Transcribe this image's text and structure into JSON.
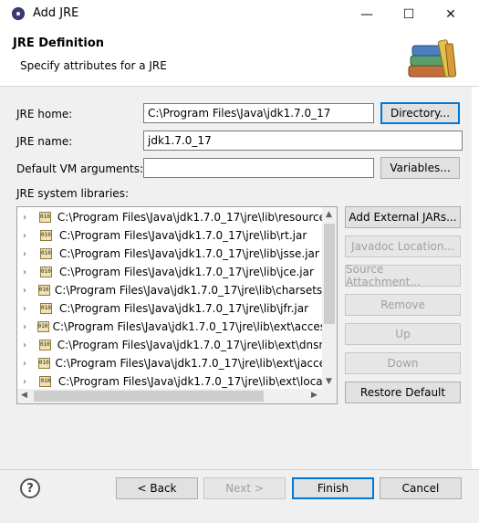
{
  "window": {
    "title": "Add JRE",
    "minimize_glyph": "—",
    "maximize_glyph": "☐",
    "close_glyph": "✕"
  },
  "header": {
    "title": "JRE Definition",
    "message": "Specify attributes for a JRE",
    "icon": "books-icon"
  },
  "form": {
    "jre_home_label": "JRE home:",
    "jre_home_value": "C:\\Program Files\\Java\\jdk1.7.0_17",
    "directory_button": "Directory...",
    "jre_name_label": "JRE name:",
    "jre_name_value": "jdk1.7.0_17",
    "vm_args_label": "Default VM arguments:",
    "vm_args_value": "",
    "variables_button": "Variables...",
    "libraries_label": "JRE system libraries:"
  },
  "libraries": [
    {
      "path": "C:\\Program Files\\Java\\jdk1.7.0_17\\jre\\lib\\resource",
      "icon": "jar-icon"
    },
    {
      "path": "C:\\Program Files\\Java\\jdk1.7.0_17\\jre\\lib\\rt.jar",
      "icon": "jar-icon"
    },
    {
      "path": "C:\\Program Files\\Java\\jdk1.7.0_17\\jre\\lib\\jsse.jar",
      "icon": "jar-icon"
    },
    {
      "path": "C:\\Program Files\\Java\\jdk1.7.0_17\\jre\\lib\\jce.jar",
      "icon": "jar-icon"
    },
    {
      "path": "C:\\Program Files\\Java\\jdk1.7.0_17\\jre\\lib\\charsets.",
      "icon": "jar-icon"
    },
    {
      "path": "C:\\Program Files\\Java\\jdk1.7.0_17\\jre\\lib\\jfr.jar",
      "icon": "jar-icon"
    },
    {
      "path": "C:\\Program Files\\Java\\jdk1.7.0_17\\jre\\lib\\ext\\acces",
      "icon": "jar-icon"
    },
    {
      "path": "C:\\Program Files\\Java\\jdk1.7.0_17\\jre\\lib\\ext\\dnsn",
      "icon": "jar-icon"
    },
    {
      "path": "C:\\Program Files\\Java\\jdk1.7.0_17\\jre\\lib\\ext\\jacce",
      "icon": "jar-icon"
    },
    {
      "path": "C:\\Program Files\\Java\\jdk1.7.0_17\\jre\\lib\\ext\\local",
      "icon": "jar-icon"
    }
  ],
  "library_buttons": {
    "add_external": "Add External JARs...",
    "javadoc": "Javadoc Location...",
    "source": "Source Attachment...",
    "remove": "Remove",
    "up": "Up",
    "down": "Down",
    "restore": "Restore Default"
  },
  "footer": {
    "back": "< Back",
    "next": "Next >",
    "finish": "Finish",
    "cancel": "Cancel"
  }
}
